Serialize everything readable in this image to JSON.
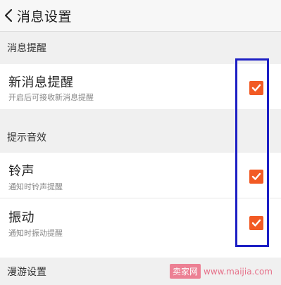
{
  "header": {
    "title": "消息设置",
    "back_icon": "chevron-left-icon"
  },
  "sections": [
    {
      "label": "消息提醒",
      "items": [
        {
          "title": "新消息提醒",
          "subtitle": "开启后可接收新消息提醒",
          "checked": true
        }
      ]
    },
    {
      "label": "提示音效",
      "items": [
        {
          "title": "铃声",
          "subtitle": "通知时铃声提醒",
          "checked": true
        },
        {
          "title": "振动",
          "subtitle": "通知时振动提醒",
          "checked": true
        }
      ]
    },
    {
      "label": "漫游设置",
      "items": []
    }
  ],
  "watermark": {
    "logo_text": "卖家网",
    "url_text": "www.maijia.com"
  },
  "colors": {
    "checkbox": "#f25a24",
    "highlight_frame": "#1d1fc4",
    "section_bg": "#f0f0f0",
    "watermark": "#e55a78"
  }
}
